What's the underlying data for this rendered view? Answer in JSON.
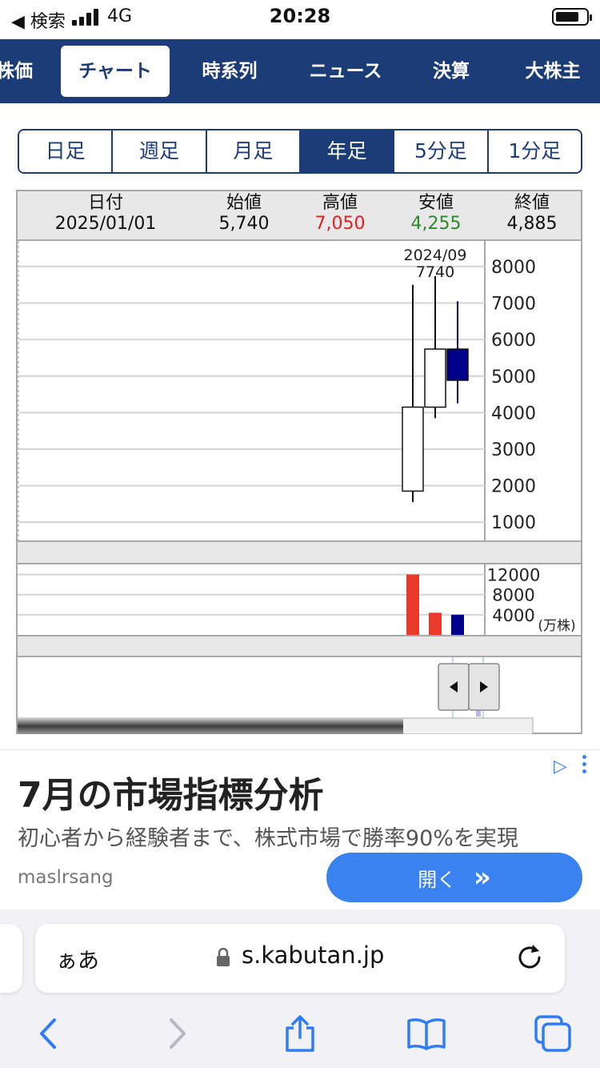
{
  "status_bar": {
    "back_label": "◀ 検索",
    "network": "4G",
    "time": "20:28"
  },
  "nav": {
    "tabs": [
      {
        "label": "株価"
      },
      {
        "label": "チャート",
        "active": true
      },
      {
        "label": "時系列"
      },
      {
        "label": "ニュース"
      },
      {
        "label": "決算"
      },
      {
        "label": "大株主"
      }
    ]
  },
  "periods": [
    {
      "label": "日足"
    },
    {
      "label": "週足"
    },
    {
      "label": "月足"
    },
    {
      "label": "年足",
      "active": true
    },
    {
      "label": "5分足"
    },
    {
      "label": "1分足"
    }
  ],
  "ohlc": {
    "date_label": "日付",
    "date_value": "2025/01/01",
    "open_label": "始値",
    "open_value": "5,740",
    "high_label": "高値",
    "high_value": "7,050",
    "low_label": "安値",
    "low_value": "4,255",
    "close_label": "終値",
    "close_value": "4,885",
    "high_color": "#e02020",
    "low_color": "#2a8a2a"
  },
  "chart_data": {
    "type": "candlestick",
    "price_axis": {
      "ticks": [
        8000,
        7000,
        6000,
        5000,
        4000,
        3000,
        2000,
        1000
      ],
      "range": [
        500,
        8700
      ]
    },
    "annotation": {
      "line1": "2024/09",
      "line2": "7740"
    },
    "candles": [
      {
        "open": 1850,
        "high": 7500,
        "low": 1550,
        "close": 4150,
        "color": "#ffffff"
      },
      {
        "open": 4150,
        "high": 7740,
        "low": 3850,
        "close": 5740,
        "color": "#ffffff"
      },
      {
        "open": 5740,
        "high": 7050,
        "low": 4255,
        "close": 4885,
        "color": "#00008b"
      }
    ],
    "volume_axis": {
      "ticks": [
        12000,
        8000,
        4000
      ],
      "unit": "(万株)",
      "range": [
        0,
        14000
      ]
    },
    "volumes": [
      {
        "value": 12000,
        "color": "#e8392a"
      },
      {
        "value": 4400,
        "color": "#e8392a"
      },
      {
        "value": 4000,
        "color": "#00008b"
      }
    ]
  },
  "ad": {
    "headline": "7月の市場指標分析",
    "description": "初心者から経験者まで、株式市場で勝率90%を実現",
    "sponsor": "maslrsang",
    "open_label": "開く",
    "open_arrow": "»",
    "accent": "#3a82f0"
  },
  "browser": {
    "aa_label": "ぁあ",
    "url": "s.kabutan.jp"
  }
}
